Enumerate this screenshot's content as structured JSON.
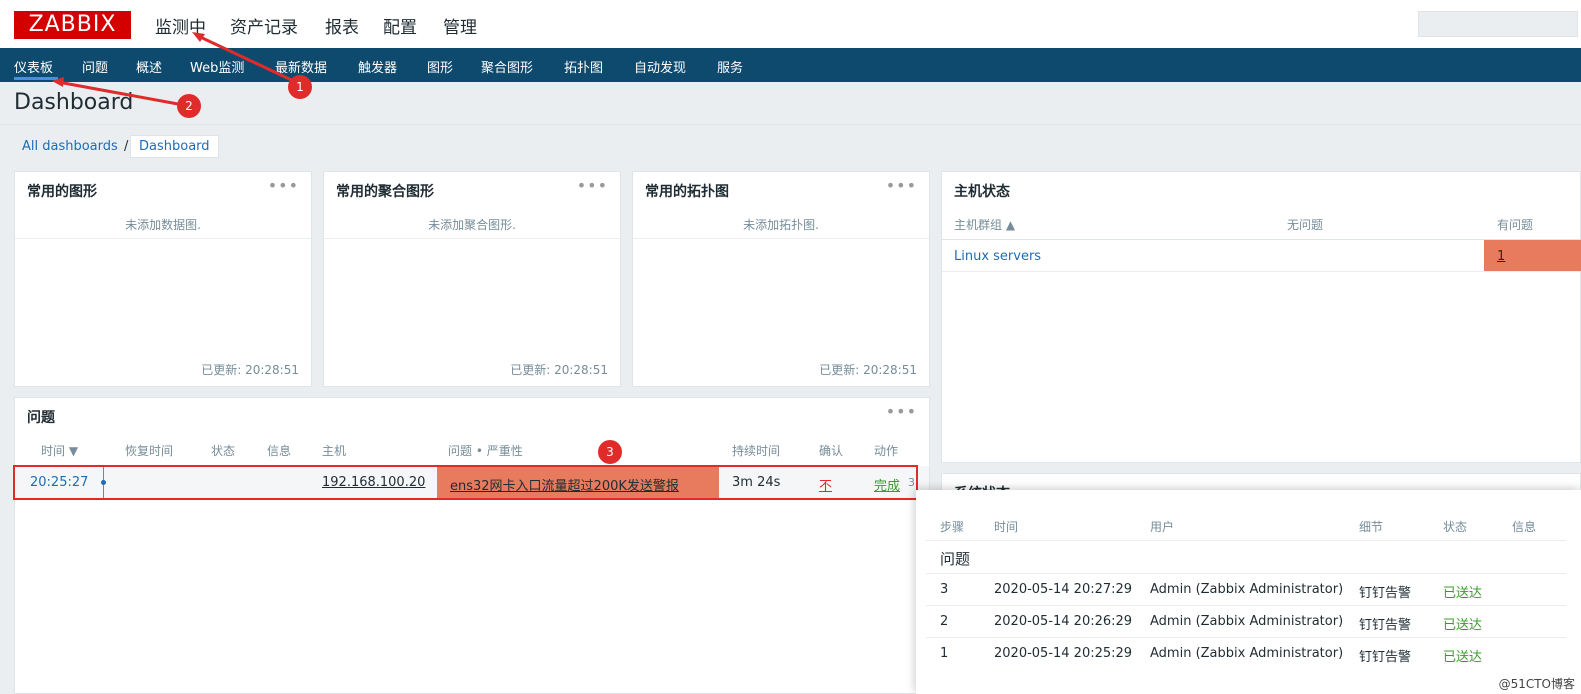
{
  "header": {
    "logo": "ZABBIX",
    "menu": [
      "监测中",
      "资产记录",
      "报表",
      "配置",
      "管理"
    ]
  },
  "subnav": [
    "仪表板",
    "问题",
    "概述",
    "Web监测",
    "最新数据",
    "触发器",
    "图形",
    "聚合图形",
    "拓扑图",
    "自动发现",
    "服务"
  ],
  "page": {
    "title": "Dashboard",
    "breadcrumb_all": "All dashboards",
    "breadcrumb_sep": "/",
    "breadcrumb_current": "Dashboard"
  },
  "widgets": {
    "graphs": {
      "title": "常用的图形",
      "empty": "未添加数据图.",
      "updated": "已更新: 20:28:51"
    },
    "screens": {
      "title": "常用的聚合图形",
      "empty": "未添加聚合图形.",
      "updated": "已更新: 20:28:51"
    },
    "maps": {
      "title": "常用的拓扑图",
      "empty": "未添加拓扑图.",
      "updated": "已更新: 20:28:51"
    },
    "dots": "•••"
  },
  "host_status": {
    "title": "主机状态",
    "col_group": "主机群组 ▲",
    "col_ok": "无问题",
    "col_problem": "有问题",
    "row_group": "Linux servers",
    "row_problem": "1"
  },
  "problems": {
    "title": "问题",
    "cols": [
      "时间 ▼",
      "恢复时间",
      "状态",
      "信息",
      "主机",
      "问题 • 严重性",
      "持续时间",
      "确认",
      "动作"
    ],
    "row": {
      "time": "20:25:27",
      "host": "192.168.100.20",
      "problem": "ens32网卡入口流量超过200K发送警报",
      "duration": "3m 24s",
      "ack": "不",
      "action": "完成",
      "action_count": "3"
    }
  },
  "system_status": {
    "title": "系统状态"
  },
  "popup": {
    "cols": [
      "步骤",
      "时间",
      "用户",
      "细节",
      "状态",
      "信息"
    ],
    "section": "问题",
    "rows": [
      {
        "step": "3",
        "time": "2020-05-14 20:27:29",
        "user": "Admin (Zabbix Administrator)",
        "detail": "钉钉告警",
        "status": "已送达"
      },
      {
        "step": "2",
        "time": "2020-05-14 20:26:29",
        "user": "Admin (Zabbix Administrator)",
        "detail": "钉钉告警",
        "status": "已送达"
      },
      {
        "step": "1",
        "time": "2020-05-14 20:25:29",
        "user": "Admin (Zabbix Administrator)",
        "detail": "钉钉告警",
        "status": "已送达"
      }
    ]
  },
  "annotations": [
    "1",
    "2",
    "3"
  ],
  "watermark": "@51CTO博客",
  "colors": {
    "accent_red": "#e02b2b",
    "problem_cell": "#e87a5d",
    "nav": "#0e4a6e",
    "link": "#1f6bb5",
    "success": "#3a9b2a"
  }
}
